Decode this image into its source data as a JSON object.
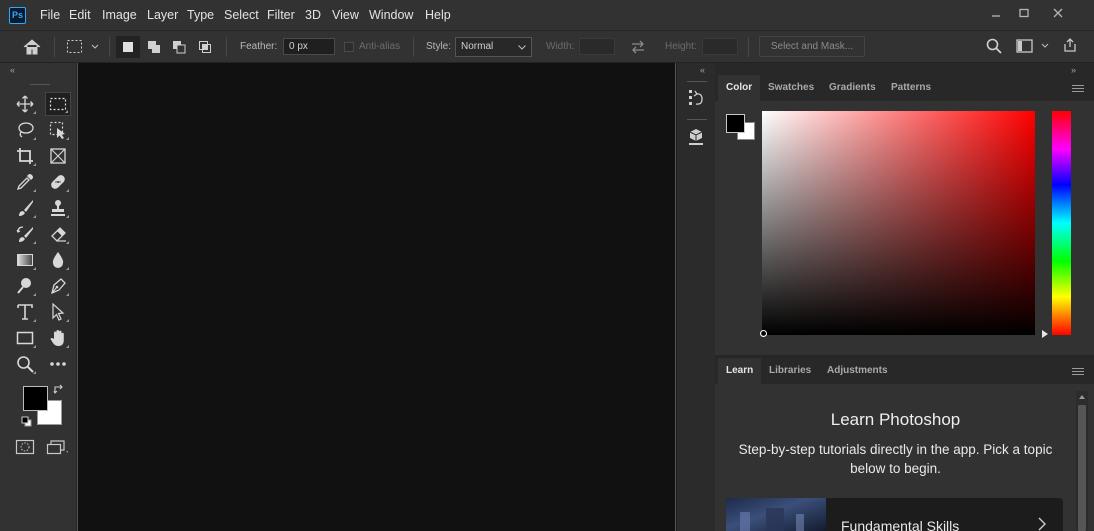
{
  "app": {
    "logo": "Ps"
  },
  "menu": [
    "File",
    "Edit",
    "Image",
    "Layer",
    "Type",
    "Select",
    "Filter",
    "3D",
    "View",
    "Window",
    "Help"
  ],
  "options": {
    "feather_label": "Feather:",
    "feather_value": "0 px",
    "antialias_label": "Anti-alias",
    "style_label": "Style:",
    "style_value": "Normal",
    "width_label": "Width:",
    "height_label": "Height:",
    "select_mask_label": "Select and Mask..."
  },
  "color_panel": {
    "tabs": [
      "Color",
      "Swatches",
      "Gradients",
      "Patterns"
    ],
    "active_tab": "Color",
    "foreground": "#000000",
    "background": "#ffffff",
    "hue": "#ff0000"
  },
  "learn_panel": {
    "tabs": [
      "Learn",
      "Libraries",
      "Adjustments"
    ],
    "active_tab": "Learn",
    "title": "Learn Photoshop",
    "subtitle": "Step-by-step tutorials directly in the app. Pick a topic below to begin.",
    "card_title": "Fundamental Skills"
  },
  "tools": [
    "move-tool-icon",
    "marquee-tool-icon",
    "lasso-tool-icon",
    "object-selection-tool-icon",
    "crop-tool-icon",
    "frame-tool-icon",
    "eyedropper-tool-icon",
    "healing-brush-tool-icon",
    "brush-tool-icon",
    "clone-stamp-tool-icon",
    "history-brush-tool-icon",
    "eraser-tool-icon",
    "gradient-tool-icon",
    "blur-tool-icon",
    "dodge-tool-icon",
    "pen-tool-icon",
    "type-tool-icon",
    "path-selection-tool-icon",
    "rectangle-tool-icon",
    "hand-tool-icon",
    "zoom-tool-icon",
    "more-tools-icon"
  ]
}
